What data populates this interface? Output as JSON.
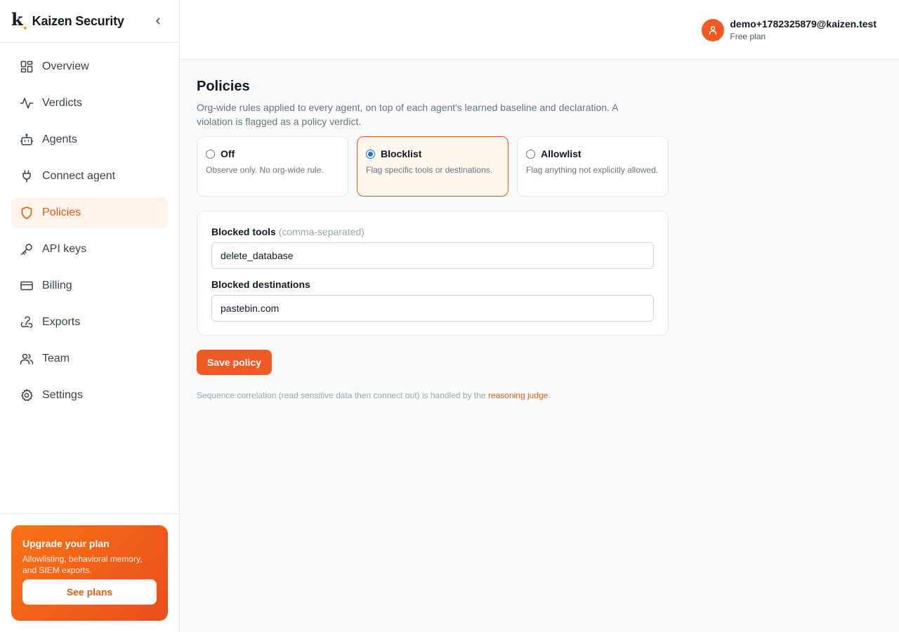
{
  "brand": {
    "logo": "k",
    "name": "Kaizen Security"
  },
  "nav": {
    "items": [
      {
        "label": "Overview",
        "icon": "grid-icon"
      },
      {
        "label": "Verdicts",
        "icon": "activity-icon"
      },
      {
        "label": "Agents",
        "icon": "bot-icon"
      },
      {
        "label": "Connect agent",
        "icon": "plug-icon"
      },
      {
        "label": "Policies",
        "icon": "shield-icon",
        "active": true
      },
      {
        "label": "API keys",
        "icon": "key-icon"
      },
      {
        "label": "Billing",
        "icon": "credit-card-icon"
      },
      {
        "label": "Exports",
        "icon": "webhook-icon"
      },
      {
        "label": "Team",
        "icon": "users-icon"
      },
      {
        "label": "Settings",
        "icon": "gear-icon"
      }
    ]
  },
  "upgrade": {
    "title": "Upgrade your plan",
    "text": "Allowlisting, behavioral memory, and SIEM exports.",
    "button": "See plans"
  },
  "user": {
    "email": "demo+1782325879@kaizen.test",
    "plan": "Free plan"
  },
  "page": {
    "title": "Policies",
    "description": "Org-wide rules applied to every agent, on top of each agent's learned baseline and declaration. A violation is flagged as a policy verdict."
  },
  "modes": [
    {
      "label": "Off",
      "desc": "Observe only. No org-wide rule.",
      "selected": false
    },
    {
      "label": "Blocklist",
      "desc": "Flag specific tools or destinations.",
      "selected": true
    },
    {
      "label": "Allowlist",
      "desc": "Flag anything not explicitly allowed.",
      "selected": false
    }
  ],
  "form": {
    "tools_label": "Blocked tools",
    "tools_hint": "(comma-separated)",
    "tools_value": "delete_database",
    "dest_label": "Blocked destinations",
    "dest_value": "pastebin.com"
  },
  "save_label": "Save policy",
  "footnote": {
    "text": "Sequence correlation (read sensitive data then connect out) is handled by the ",
    "link": "reasoning judge",
    "end": "."
  },
  "colors": {
    "accent": "#f05a22",
    "active_bg": "#fff4ec",
    "border": "#e5e7eb"
  }
}
